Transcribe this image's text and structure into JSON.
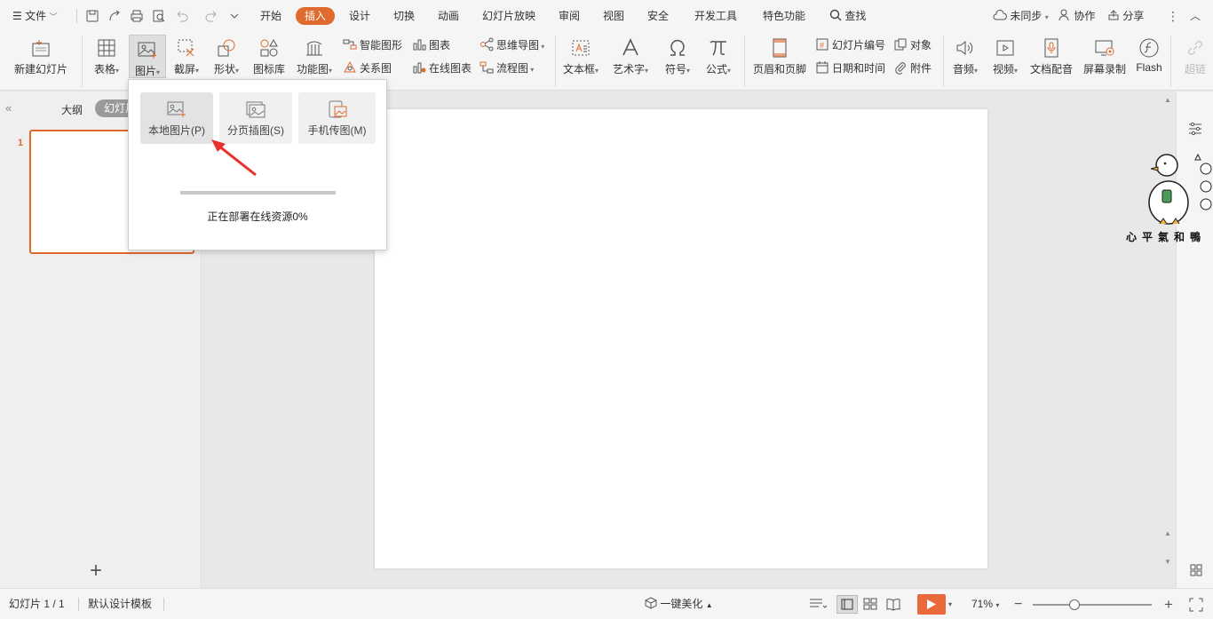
{
  "menubar": {
    "file_label": "文件",
    "tabs": [
      "开始",
      "插入",
      "设计",
      "切换",
      "动画",
      "幻灯片放映",
      "审阅",
      "视图",
      "安全",
      "开发工具",
      "特色功能"
    ],
    "active_tab": "插入",
    "search_label": "查找",
    "sync_label": "未同步",
    "collab_label": "协作",
    "share_label": "分享"
  },
  "ribbon": {
    "new_slide": "新建幻灯片",
    "table": "表格",
    "picture": "图片",
    "screenshot": "截屏",
    "shape": "形状",
    "icon_lib": "图标库",
    "func_chart": "功能图",
    "smart_art": "智能图形",
    "chart": "图表",
    "relation": "关系图",
    "online_chart": "在线图表",
    "mind_map": "思维导图",
    "flowchart": "流程图",
    "textbox": "文本框",
    "wordart": "艺术字",
    "symbol": "符号",
    "formula": "公式",
    "header_footer": "页眉和页脚",
    "slide_number": "幻灯片编号",
    "object": "对象",
    "date_time": "日期和时间",
    "attachment": "附件",
    "audio": "音频",
    "video": "视频",
    "doc_dub": "文档配音",
    "screen_rec": "屏幕录制",
    "flash": "Flash",
    "hyperlink": "超链"
  },
  "dropdown": {
    "options": [
      "本地图片(P)",
      "分页插图(S)",
      "手机传图(M)"
    ],
    "progress_text": "正在部署在线资源0%",
    "progress_percent": 0
  },
  "leftpanel": {
    "tab_outline": "大纲",
    "tab_slides": "幻灯片",
    "slide_number": "1",
    "add_label": "+"
  },
  "sticker": {
    "caption": "心平氣和鴨"
  },
  "statusbar": {
    "slide_info": "幻灯片 1 / 1",
    "template": "默认设计模板",
    "beautify": "一键美化",
    "zoom": "71%"
  },
  "colors": {
    "accent": "#e0692e"
  }
}
